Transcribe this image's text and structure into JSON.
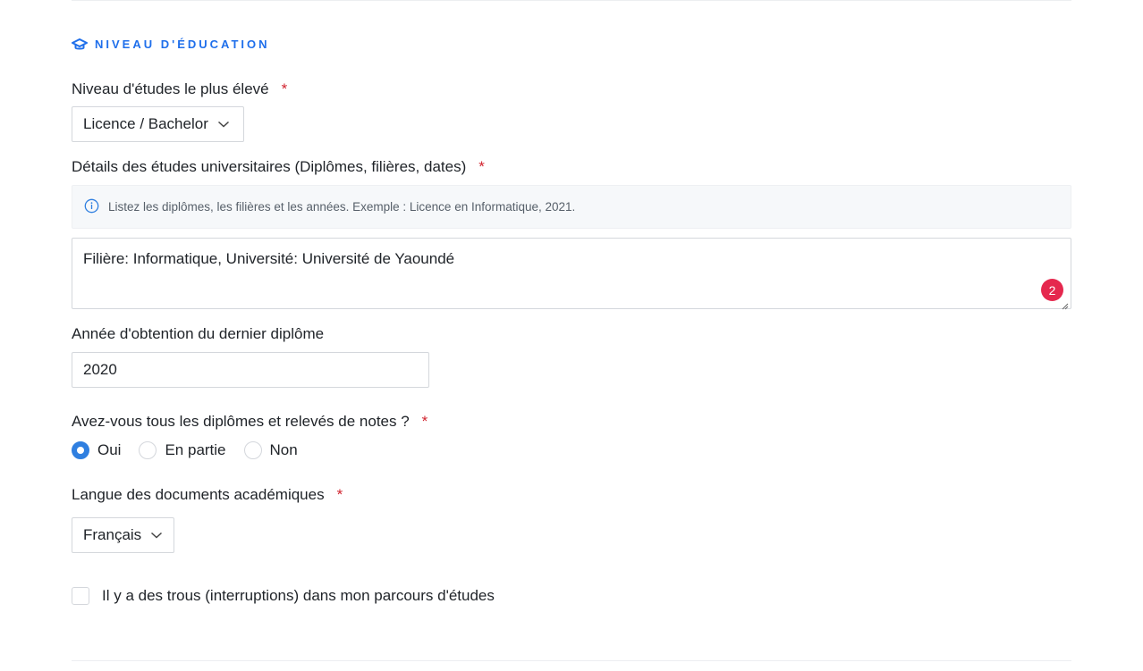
{
  "section": {
    "title": "NIVEAU D'ÉDUCATION",
    "icon": "graduation-cap-icon",
    "accent_color": "#1f6feb"
  },
  "highest_level": {
    "label": "Niveau d'études le plus élevé",
    "required_mark": "*",
    "value": "Licence / Bachelor"
  },
  "university_details": {
    "label": "Détails des études universitaires (Diplômes, filières, dates)",
    "required_mark": "*",
    "hint": "Listez les diplômes, les filières et les années. Exemple : Licence en Informatique, 2021.",
    "value": "Filière: Informatique, Université: Université de Yaoundé",
    "issue_count": "2"
  },
  "graduation_year": {
    "label": "Année d'obtention du dernier diplôme",
    "value": "2020"
  },
  "all_diplomas": {
    "label": "Avez-vous tous les diplômes et relevés de notes ?",
    "required_mark": "*",
    "options": [
      "Oui",
      "En partie",
      "Non"
    ],
    "selected": "Oui"
  },
  "documents_language": {
    "label": "Langue des documents académiques",
    "required_mark": "*",
    "value": "Français"
  },
  "gaps_checkbox": {
    "label": "Il y a des trous (interruptions) dans mon parcours d'études",
    "checked": false
  }
}
